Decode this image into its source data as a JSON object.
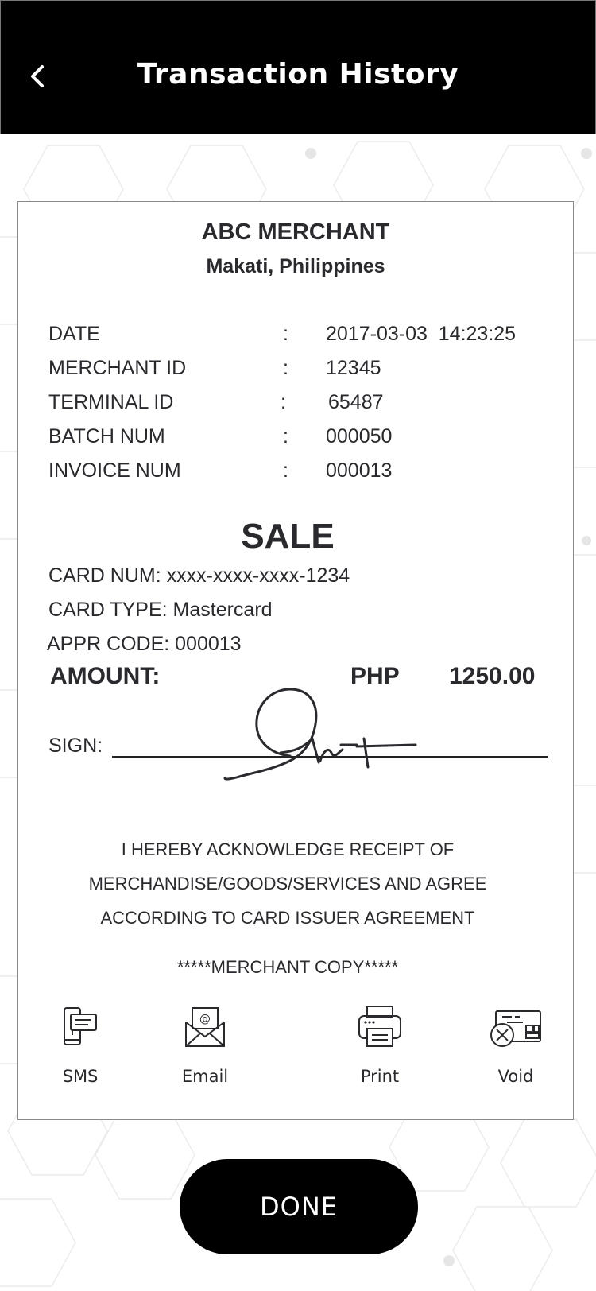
{
  "header": {
    "title": "Transaction History",
    "back_icon": "chevron-left-icon"
  },
  "receipt": {
    "merchant_name": "ABC MERCHANT",
    "merchant_location": "Makati, Philippines",
    "info": [
      {
        "label": "DATE",
        "value": "2017-03-03  14:23:25"
      },
      {
        "label": "MERCHANT ID",
        "value": "12345"
      },
      {
        "label": "TERMINAL ID",
        "value": "65487"
      },
      {
        "label": "BATCH NUM",
        "value": "000050"
      },
      {
        "label": "INVOICE NUM",
        "value": "000013"
      }
    ],
    "colon": ":",
    "sale_title": "SALE",
    "card_num": "CARD NUM: xxxx-xxxx-xxxx-1234",
    "card_type": "CARD TYPE: Mastercard",
    "appr_code": "APPR CODE: 000013",
    "amount_label": "AMOUNT:",
    "amount_currency": "PHP",
    "amount_value": "1250.00",
    "sign_label": "SIGN:",
    "acknowledgement": [
      "I HEREBY ACKNOWLEDGE RECEIPT OF",
      "MERCHANDISE/GOODS/SERVICES AND AGREE",
      "ACCORDING TO CARD ISSUER AGREEMENT"
    ],
    "copy_label": "*****MERCHANT COPY*****"
  },
  "actions": [
    {
      "label": "SMS",
      "icon": "sms-phone-icon"
    },
    {
      "label": "Email",
      "icon": "email-envelope-icon"
    },
    {
      "label": "Print",
      "icon": "printer-icon"
    },
    {
      "label": "Void",
      "icon": "void-card-icon"
    }
  ],
  "done_label": "DONE",
  "colors": {
    "header_bg": "#000000",
    "button_bg": "#000000",
    "text": "#2a2a2e",
    "pattern": "#ececec"
  }
}
